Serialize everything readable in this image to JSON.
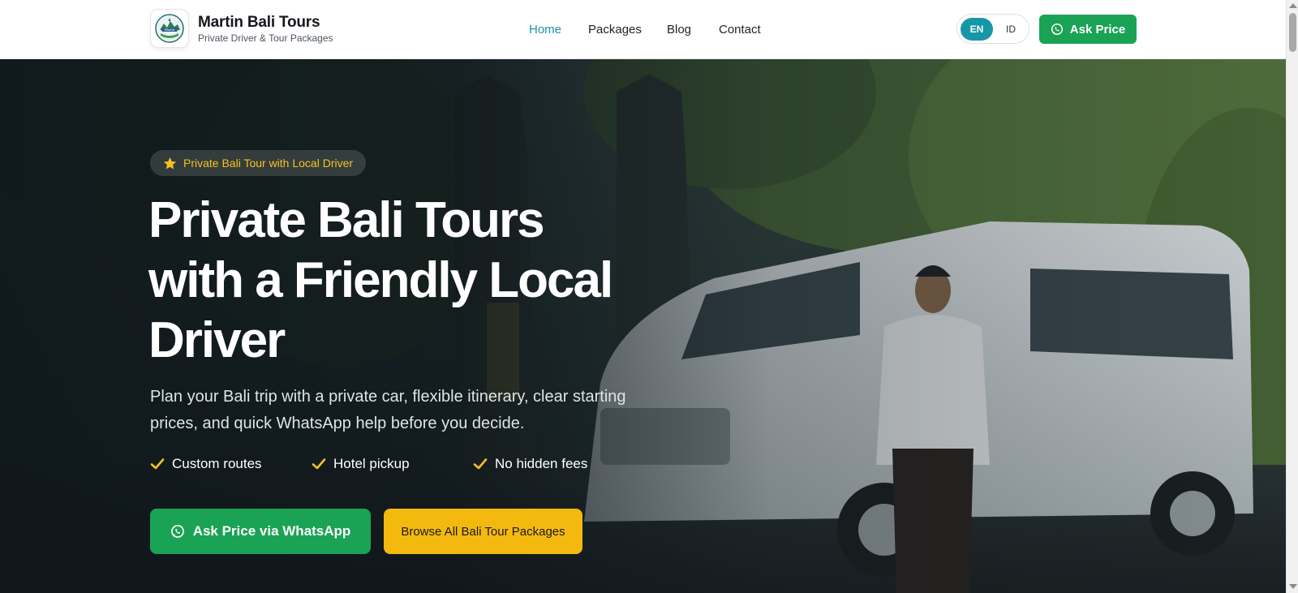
{
  "brand": {
    "title": "Martin Bali Tours",
    "subtitle": "Private Driver & Tour Packages",
    "logo_text": "Martin"
  },
  "nav": [
    {
      "label": "Home",
      "active": true
    },
    {
      "label": "Packages",
      "active": false
    },
    {
      "label": "Blog",
      "active": false
    },
    {
      "label": "Contact",
      "active": false
    }
  ],
  "lang": {
    "selected": "EN",
    "other": "ID"
  },
  "header_cta": "Ask Price",
  "hero": {
    "badge": "Private Bali Tour with Local Driver",
    "headline_lines": [
      "Private Bali Tours",
      "with a Friendly Local",
      "Driver"
    ],
    "lede": "Plan your Bali trip with a private car, flexible itinerary, clear starting prices, and quick WhatsApp help before you decide.",
    "features": [
      "Custom routes",
      "Hotel pickup",
      "No hidden fees"
    ],
    "primary_cta": "Ask Price via WhatsApp",
    "secondary_cta": "Browse All Bali Tour Packages"
  },
  "colors": {
    "accent_teal": "#1796a8",
    "whatsapp_green": "#1aa354",
    "cta_yellow": "#f4b90f",
    "badge_gold": "#f6c120"
  },
  "icons": {
    "header_cta": "whatsapp-icon",
    "badge": "star-icon",
    "features": "check-icon",
    "primary_cta": "whatsapp-icon"
  }
}
